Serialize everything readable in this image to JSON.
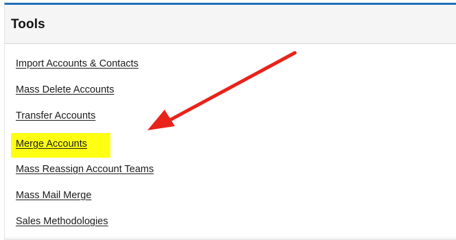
{
  "panel": {
    "title": "Tools",
    "accent_color": "#1f6fb8"
  },
  "tools": [
    {
      "label": "Import Accounts & Contacts",
      "highlighted": false
    },
    {
      "label": "Mass Delete Accounts",
      "highlighted": false
    },
    {
      "label": "Transfer Accounts",
      "highlighted": false
    },
    {
      "label": "Merge Accounts",
      "highlighted": true
    },
    {
      "label": "Mass Reassign Account Teams",
      "highlighted": false
    },
    {
      "label": "Mass Mail Merge",
      "highlighted": false
    },
    {
      "label": "Sales Methodologies",
      "highlighted": false
    }
  ],
  "annotation": {
    "arrow_color": "#e8231a",
    "highlight_color": "#ffff14",
    "icon": "red-arrow-icon"
  }
}
